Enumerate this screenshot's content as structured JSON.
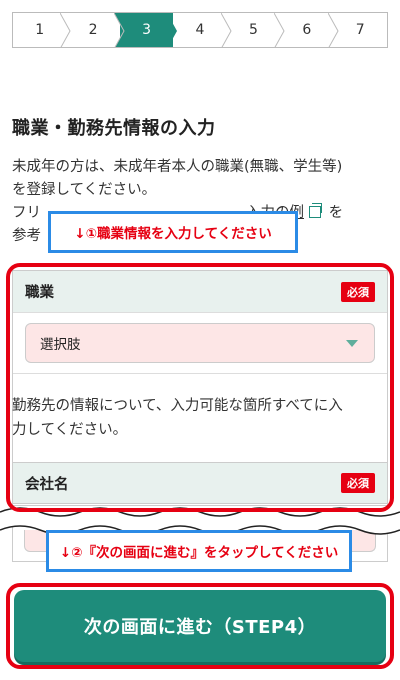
{
  "stepper": {
    "steps": [
      "1",
      "2",
      "3",
      "4",
      "5",
      "6",
      "7"
    ],
    "active_index": 2,
    "active_color": "#1e8c7b"
  },
  "page_title": "職業・勤務先情報の入力",
  "description": {
    "line1": "未成年の方は、未成年者本人の職業(無職、学生等)",
    "line2": "を登録してください。",
    "line3_prefix": "フリ",
    "link_text": "入力の例",
    "line3_suffix": "を",
    "line4": "参考"
  },
  "callouts": {
    "first": "↓①職業情報を入力してください",
    "second": "↓②『次の画面に進む』をタップしてください",
    "text_color": "#e60012",
    "border_color": "#2b8be6"
  },
  "occupation_field": {
    "label": "職業",
    "required_badge": "必須",
    "select_value": "選択肢"
  },
  "employer_info_text": {
    "line1": "勤務先の情報について、入力可能な箇所すべてに入",
    "line2": "力してください。"
  },
  "company_field": {
    "label": "会社名",
    "required_badge": "必須"
  },
  "next_button": {
    "label": "次の画面に進む（STEP4）",
    "color": "#1e8c7b"
  },
  "highlight_color": "#e60012",
  "icons": {
    "copy": "copy-icon",
    "dropdown": "chevron-down-icon"
  }
}
